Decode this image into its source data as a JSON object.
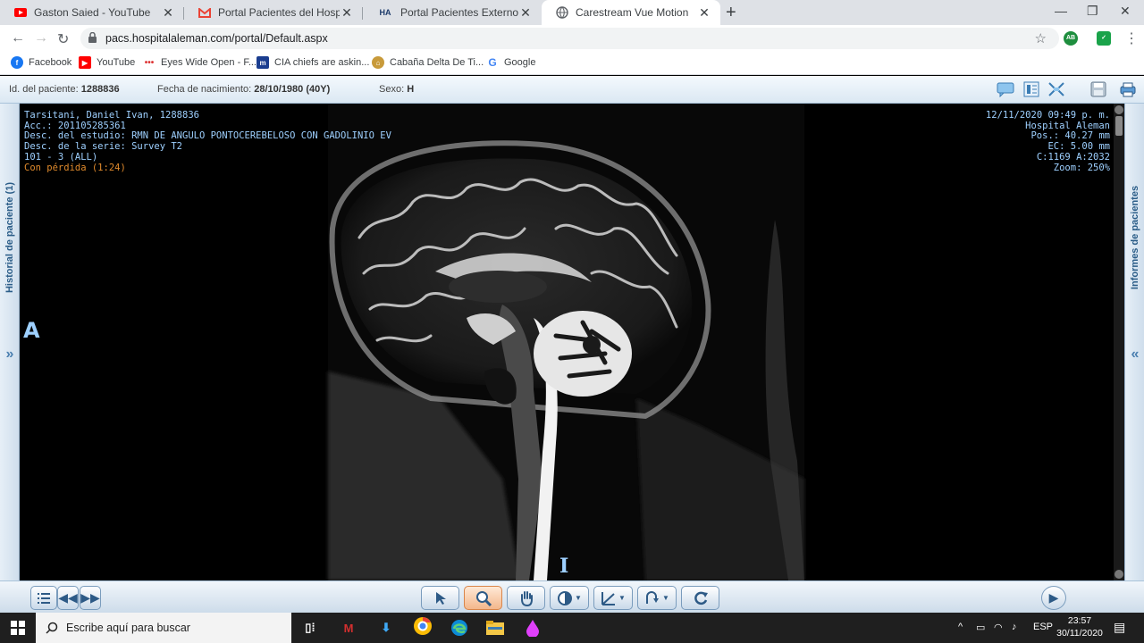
{
  "browser": {
    "tabs": [
      {
        "title": "Gaston Saied - YouTube",
        "icon": "youtube-icon"
      },
      {
        "title": "Portal Pacientes del Hospital Alem",
        "icon": "gmail-icon"
      },
      {
        "title": "Portal Pacientes Externos",
        "icon": "ha-icon"
      },
      {
        "title": "Carestream Vue Motion",
        "icon": "globe-icon"
      }
    ],
    "url": "pacs.hospitalaleman.com/portal/Default.aspx",
    "bookmarks": [
      {
        "label": "Facebook",
        "icon": "facebook-icon"
      },
      {
        "label": "YouTube",
        "icon": "youtube-icon"
      },
      {
        "label": "Eyes Wide Open - F...",
        "icon": "dots-icon"
      },
      {
        "label": "CIA chiefs are askin...",
        "icon": "m-icon"
      },
      {
        "label": "Cabaña Delta De Ti...",
        "icon": "cabin-icon"
      },
      {
        "label": "Google",
        "icon": "google-icon"
      }
    ],
    "extension_label": "AB"
  },
  "patient": {
    "id_label": "Id. del paciente:",
    "id_value": "1288836",
    "dob_label": "Fecha de nacimiento:",
    "dob_value": "28/10/1980 (40Y)",
    "sex_label": "Sexo:",
    "sex_value": "H"
  },
  "side": {
    "left_label": "Historial de paciente (1)",
    "right_label": "Informes de pacientes",
    "left_chevron": "»",
    "right_chevron": "«"
  },
  "overlay": {
    "top_left": [
      "Tarsitani, Daniel Ivan, 1288836",
      "Acc.: 201105285361",
      "Desc. del estudio: RMN DE ANGULO PONTOCEREBELOSO CON GADOLINIO EV",
      "Desc. de la serie: Survey T2",
      "101 - 3 (ALL)"
    ],
    "lossy": "Con pérdida (1:24)",
    "top_right": [
      "12/11/2020 09:49 p. m.",
      "Hospital Aleman",
      "Pos.: 40.27 mm",
      "EC: 5.00 mm",
      "C:1169 A:2032",
      "Zoom: 250%"
    ],
    "orient_left": "A",
    "orient_bottom": "I"
  },
  "taskbar": {
    "search_placeholder": "Escribe aquí para buscar",
    "lang": "ESP",
    "time": "23:57",
    "date": "30/11/2020"
  }
}
